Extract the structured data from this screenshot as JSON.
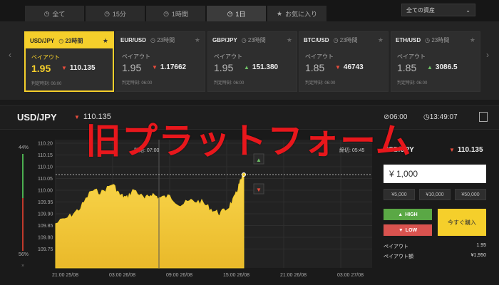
{
  "tabs": [
    {
      "icon": "◷",
      "label": "全て",
      "active": false
    },
    {
      "icon": "◷",
      "label": "15分",
      "active": false
    },
    {
      "icon": "◷",
      "label": "1時間",
      "active": false
    },
    {
      "icon": "◷",
      "label": "1日",
      "active": true
    },
    {
      "icon": "★",
      "label": "お気に入り",
      "active": false
    }
  ],
  "asset_filter": {
    "label": "全ての資産",
    "chevron": "⌄"
  },
  "cards": [
    {
      "symbol": "USD/JPY",
      "time": "◷ 23時間",
      "payout_label": "ペイアウト",
      "payout": "1.95",
      "price": "110.135",
      "dir": "down",
      "judge": "判定時刻: 06:00",
      "active": true
    },
    {
      "symbol": "EUR/USD",
      "time": "◷ 23時間",
      "payout_label": "ペイアウト",
      "payout": "1.95",
      "price": "1.17662",
      "dir": "down",
      "judge": "判定時刻: 06:00",
      "active": false
    },
    {
      "symbol": "GBP/JPY",
      "time": "◷ 23時間",
      "payout_label": "ペイアウト",
      "payout": "1.95",
      "price": "151.380",
      "dir": "up",
      "judge": "判定時刻: 06:00",
      "active": false
    },
    {
      "symbol": "BTC/USD",
      "time": "◷ 23時間",
      "payout_label": "ペイアウト",
      "payout": "1.85",
      "price": "46743",
      "dir": "down",
      "judge": "判定時刻: 06:00",
      "active": false
    },
    {
      "symbol": "ETH/USD",
      "time": "◷ 23時間",
      "payout_label": "ペイアウト",
      "payout": "1.85",
      "price": "3086.5",
      "dir": "up",
      "judge": "判定時刻: 06:00",
      "active": false
    }
  ],
  "chart_header": {
    "symbol": "USD/JPY",
    "price": "110.135",
    "expiry": "⊘06:00",
    "clock": "◷13:49:07"
  },
  "chart": {
    "yticks": [
      "110.20",
      "110.15",
      "110.10",
      "110.05",
      "110.00",
      "109.95",
      "109.90",
      "109.85",
      "109.80",
      "109.75"
    ],
    "xticks": [
      "21:00 25/08",
      "03:00 26/08",
      "09:00 26/08",
      "15:00 26/08",
      "21:00 26/08",
      "03:00 27/08"
    ],
    "start_label": "開始: 07:00",
    "end_label": "締切: 05:45",
    "current_price": "110.135",
    "pct_top": "44%",
    "pct_bottom": "56%",
    "pct_close": "×"
  },
  "panel": {
    "symbol": "USD/JPY",
    "price": "110.135",
    "amount": "¥ 1,000",
    "quick": [
      "¥5,000",
      "¥10,000",
      "¥50,000"
    ],
    "high_label": "HIGH",
    "low_label": "LOW",
    "buy_label": "今すぐ購入",
    "payout_label": "ペイアウト",
    "payout_value": "1.95",
    "payout_amount_label": "ペイアウト額",
    "payout_amount_value": "¥1,950"
  },
  "overlay_text": "旧プラットフォーム",
  "colors": {
    "accent": "#f5cf2b",
    "high": "#5aa845",
    "low": "#d9534f",
    "overlay": "#e8171c"
  }
}
